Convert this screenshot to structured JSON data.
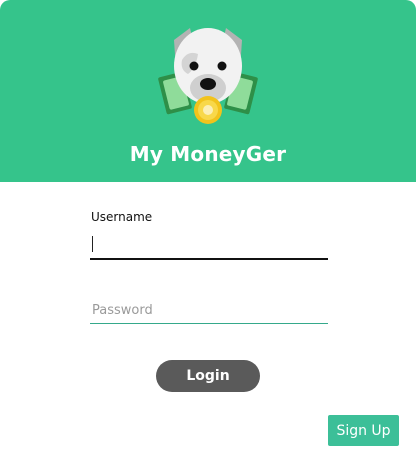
{
  "app": {
    "title": "My MoneyGer",
    "logo_icon": "dog-money-icon",
    "brand_color": "#35c48b"
  },
  "form": {
    "username_label": "Username",
    "username_value": "",
    "password_placeholder": "Password",
    "password_value": ""
  },
  "buttons": {
    "login_label": "Login",
    "signup_label": "Sign Up",
    "login_color": "#5a5a5a",
    "signup_color": "#3cbf98"
  }
}
